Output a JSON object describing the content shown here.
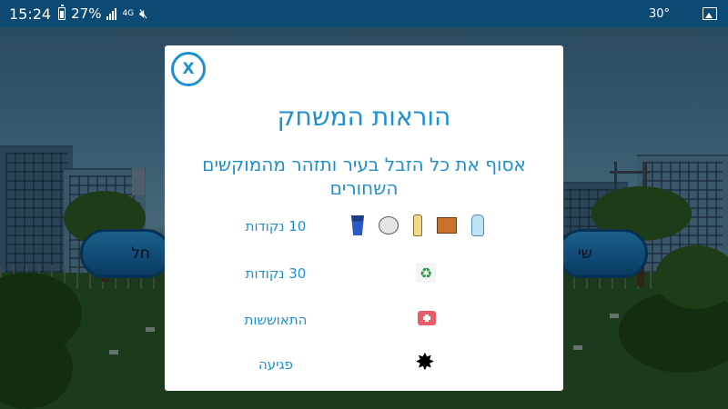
{
  "status_bar": {
    "time": "15:24",
    "battery_percent": "27%",
    "network_type": "4G",
    "temperature": "30°",
    "icons": [
      "battery-icon",
      "signal-icon",
      "network-4g-icon",
      "mute-icon",
      "image-icon"
    ]
  },
  "background": {
    "left_button_partial": "חל",
    "right_button_partial": "שי"
  },
  "modal": {
    "close_label": "X",
    "title": "הוראות המשחק",
    "subtitle": "אסוף את כל הזבל בעיר ותזהר מהמוקשים השחורים",
    "rows": [
      {
        "label": "10 נקודות",
        "icons": [
          "cup-icon",
          "crumpled-paper-icon",
          "glass-bottle-icon",
          "cardboard-box-icon",
          "water-bottle-icon"
        ]
      },
      {
        "label": "30 נקודות",
        "icons": [
          "recycle-icon"
        ]
      },
      {
        "label": "התאוששות",
        "icons": [
          "first-aid-kit-icon"
        ]
      },
      {
        "label": "פגיעה",
        "icons": [
          "black-mine-icon"
        ]
      }
    ]
  },
  "colors": {
    "accent": "#1e90d0",
    "status_bar": "#0d4a73",
    "modal_bg": "#ffffff"
  }
}
